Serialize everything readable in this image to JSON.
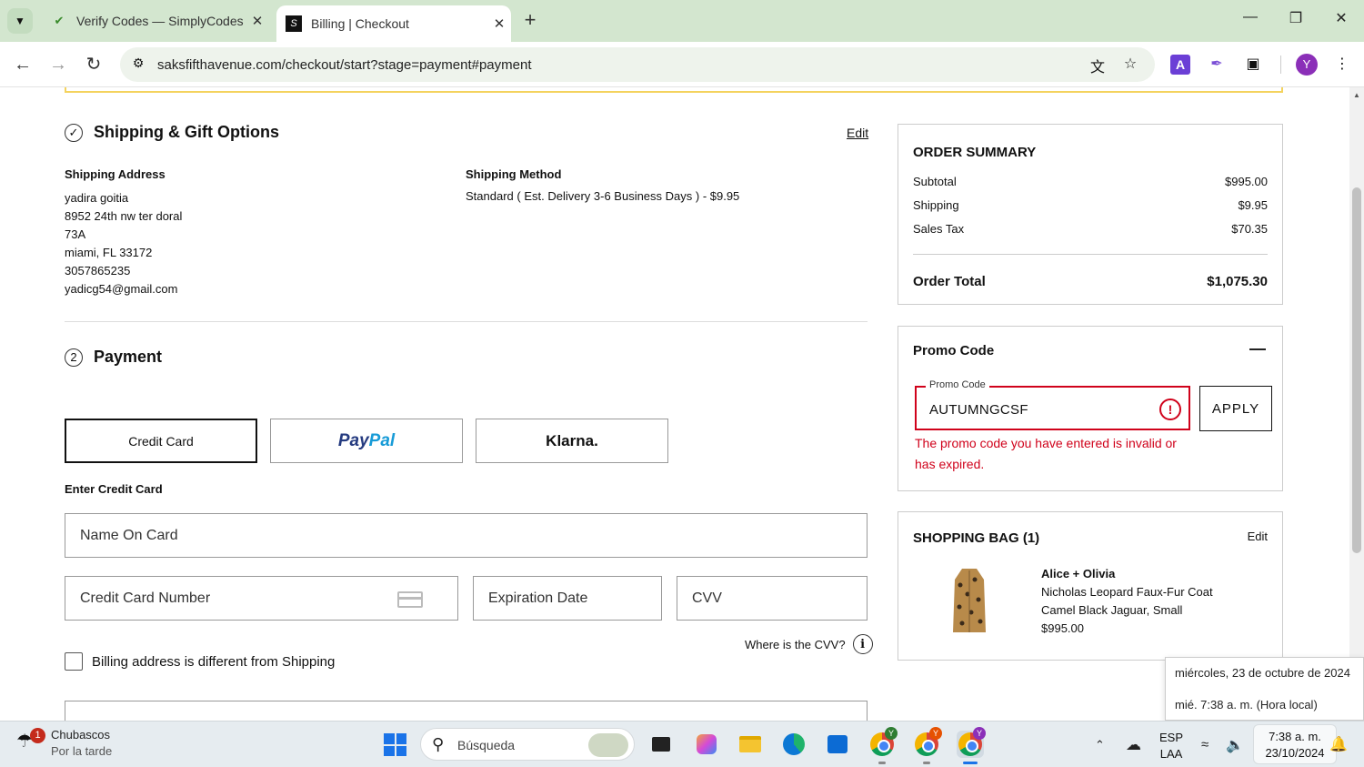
{
  "browser": {
    "tabs": [
      {
        "title": "Verify Codes — SimplyCodes",
        "active": false
      },
      {
        "title": "Billing | Checkout",
        "active": true
      }
    ],
    "url": "saksfifthavenue.com/checkout/start?stage=payment#payment",
    "profile_initial": "Y"
  },
  "shipping": {
    "title": "Shipping & Gift Options",
    "edit_label": "Edit",
    "address_label": "Shipping Address",
    "address_lines": [
      "yadira goitia",
      "8952 24th nw ter doral",
      "73A",
      "miami, FL 33172",
      "3057865235",
      "yadicg54@gmail.com"
    ],
    "method_label": "Shipping Method",
    "method_value": "Standard ( Est. Delivery 3-6 Business Days ) - $9.95"
  },
  "payment": {
    "step_number": "2",
    "title": "Payment",
    "options": {
      "credit_card": "Credit Card",
      "paypal_a": "Pay",
      "paypal_b": "Pal",
      "klarna": "Klarna."
    },
    "enter_label": "Enter Credit Card",
    "name_placeholder": "Name On Card",
    "number_placeholder": "Credit Card Number",
    "expiry_placeholder": "Expiration Date",
    "cvv_placeholder": "CVV",
    "cvv_help": "Where is the CVV?",
    "billing_diff_label": "Billing address is different from Shipping"
  },
  "order_summary": {
    "title": "ORDER SUMMARY",
    "rows": [
      {
        "label": "Subtotal",
        "value": "$995.00"
      },
      {
        "label": "Shipping",
        "value": "$9.95"
      },
      {
        "label": "Sales Tax",
        "value": "$70.35"
      }
    ],
    "total_label": "Order Total",
    "total_value": "$1,075.30"
  },
  "promo": {
    "title": "Promo Code",
    "field_label": "Promo Code",
    "value": "AUTUMNGCSF",
    "apply_label": "APPLY",
    "error": "The promo code you have entered is invalid or has expired."
  },
  "bag": {
    "title": "SHOPPING BAG (1)",
    "edit_label": "Edit",
    "brand": "Alice + Olivia",
    "product": "Nicholas Leopard Faux-Fur Coat",
    "variant": "Camel Black Jaguar, Small",
    "price": "$995.00"
  },
  "tooltip": {
    "line1": "miércoles, 23 de octubre de 2024",
    "line2": "mié. 7:38 a. m. (Hora local)"
  },
  "taskbar": {
    "weather_title": "Chubascos",
    "weather_sub": "Por la tarde",
    "weather_badge": "1",
    "search_placeholder": "Búsqueda",
    "lang_top": "ESP",
    "lang_bottom": "LAA",
    "time": "7:38 a. m.",
    "date": "23/10/2024"
  },
  "colors": {
    "error": "#d0021b",
    "tabbar": "#d3e6cf",
    "paypal_dark": "#253b80",
    "paypal_light": "#179bd7"
  }
}
